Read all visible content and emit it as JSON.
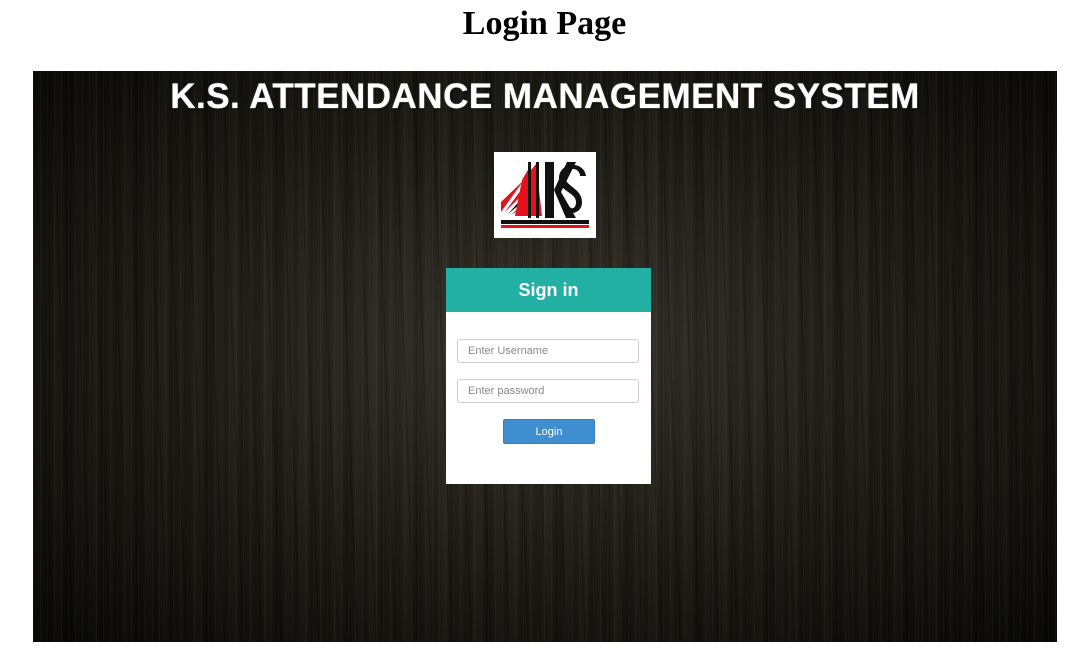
{
  "page": {
    "heading": "Login Page"
  },
  "app": {
    "title": "K.S. ATTENDANCE MANAGEMENT SYSTEM",
    "logo_text": "KS"
  },
  "login": {
    "header": "Sign in",
    "username_placeholder": "Enter Username",
    "password_placeholder": "Enter password",
    "button_label": "Login"
  },
  "colors": {
    "header_teal": "#22b0a5",
    "button_blue": "#3e8ed0",
    "logo_red": "#e3121c",
    "background_dark": "#1b1a15"
  }
}
